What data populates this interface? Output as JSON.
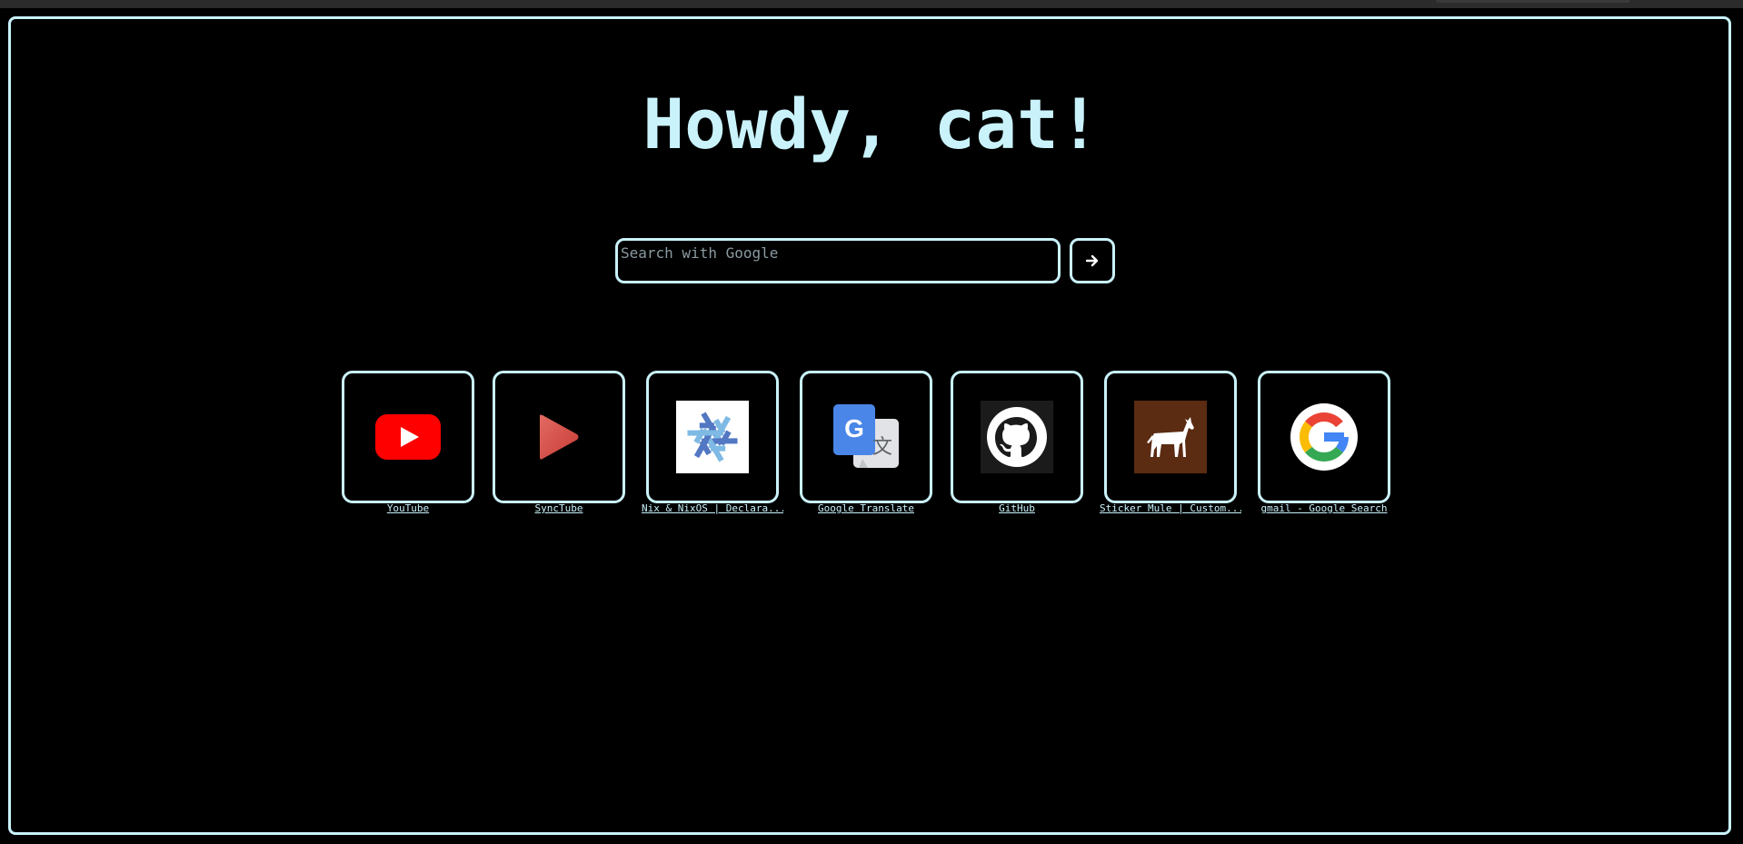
{
  "greeting": "Howdy, cat!",
  "search": {
    "placeholder": "Search with Google",
    "value": "",
    "button_icon": "arrow-right-icon"
  },
  "shortcuts": [
    {
      "label": "YouTube",
      "icon": "youtube-icon",
      "color": "#ff0000"
    },
    {
      "label": "SyncTube",
      "icon": "synctube-play-icon",
      "color": "#d9534f"
    },
    {
      "label": "Nix & NixOS | Declara...",
      "icon": "nixos-snowflake-icon",
      "color": "#5277c3"
    },
    {
      "label": "Google Translate",
      "icon": "google-translate-icon",
      "color": "#4285f4"
    },
    {
      "label": "GitHub",
      "icon": "github-octocat-icon",
      "color": "#1b1f23"
    },
    {
      "label": "Sticker Mule | Custom...",
      "icon": "sticker-mule-icon",
      "color": "#5b2b12"
    },
    {
      "label": "gmail - Google Search",
      "icon": "google-g-icon",
      "color": "#ffffff"
    }
  ],
  "colors": {
    "accent": "#c9f2fb",
    "background": "#000000"
  }
}
